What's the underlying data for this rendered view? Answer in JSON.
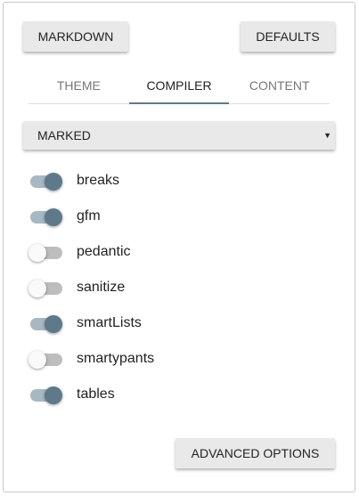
{
  "buttons": {
    "markdown": "MARKDOWN",
    "defaults": "DEFAULTS",
    "advanced": "ADVANCED OPTIONS"
  },
  "tabs": [
    {
      "label": "THEME"
    },
    {
      "label": "COMPILER",
      "active": true
    },
    {
      "label": "CONTENT"
    }
  ],
  "compiler_select": {
    "value": "MARKED",
    "arrow": "▼"
  },
  "options": [
    {
      "label": "breaks",
      "on": true
    },
    {
      "label": "gfm",
      "on": true
    },
    {
      "label": "pedantic",
      "on": false
    },
    {
      "label": "sanitize",
      "on": false
    },
    {
      "label": "smartLists",
      "on": true
    },
    {
      "label": "smartypants",
      "on": false
    },
    {
      "label": "tables",
      "on": true
    }
  ],
  "colors": {
    "accent": "#5e7a8a",
    "accent_track": "#a7b8c2"
  }
}
